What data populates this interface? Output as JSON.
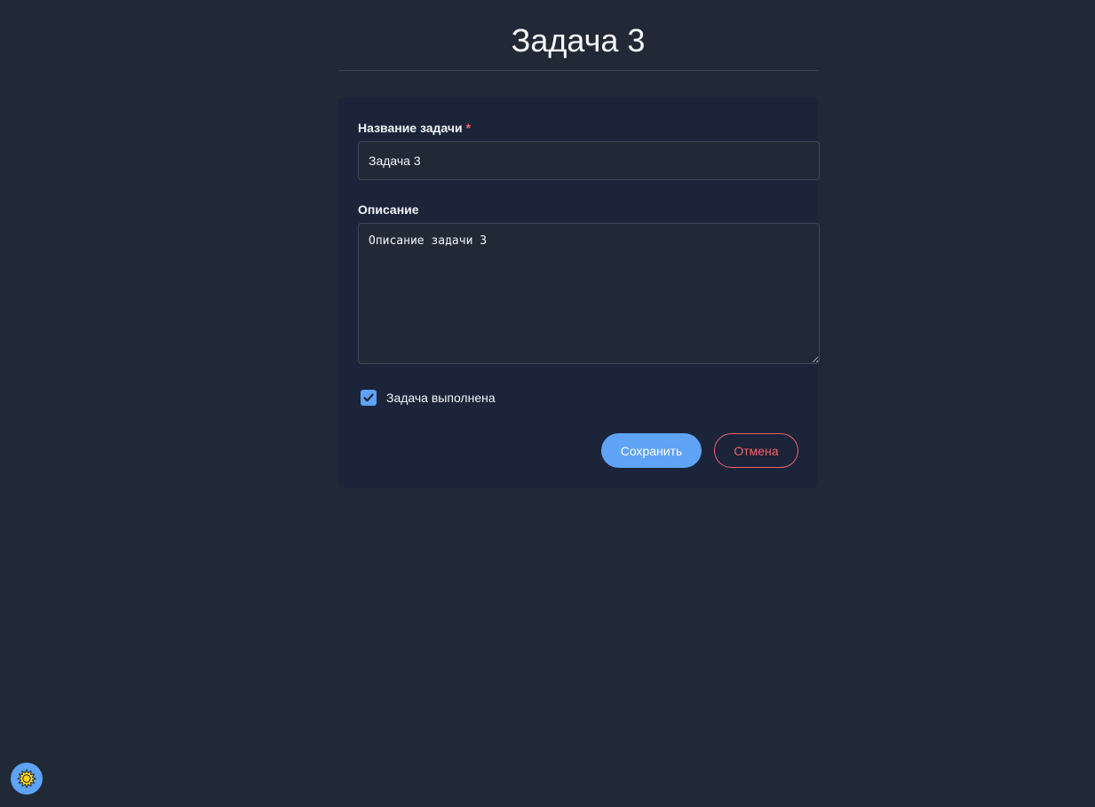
{
  "header": {
    "title": "Задача 3"
  },
  "form": {
    "title_field": {
      "label": "Название задачи",
      "required_mark": "*",
      "value": "Задача 3",
      "placeholder": ""
    },
    "description_field": {
      "label": "Описание",
      "value": "Описание задачи 3"
    },
    "completed_checkbox": {
      "label": "Задача выполнена",
      "checked": true
    },
    "save_label": "Сохранить",
    "cancel_label": "Отмена"
  },
  "theme_toggle": {
    "icon": "sun-icon"
  },
  "colors": {
    "background": "#212936",
    "card": "#1b2439",
    "accent": "#5ea3f5",
    "danger": "#f0646b",
    "sun": "#ffd21a"
  }
}
